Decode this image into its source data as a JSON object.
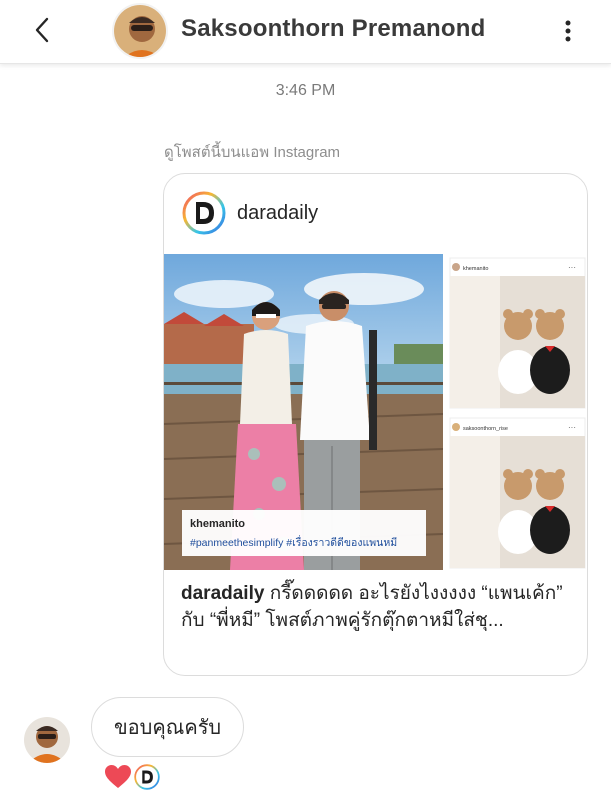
{
  "header": {
    "contact_name": "Saksoonthorn Premanond"
  },
  "chat": {
    "timestamp": "3:46 PM",
    "view_on_app": "ดูโพสต์นี้บนแอพ Instagram",
    "shared_post": {
      "account": "daradaily",
      "photo_overlay_user": "khemanito",
      "photo_overlay_tags": "#panmeethesimplify #เรื่องราวดีดีของแพนหมี",
      "side_post_1_user": "khemanito",
      "side_post_2_user": "saksoonthorn_rise",
      "caption_account": "daradaily",
      "caption_text": "กรี๊ดดดดด อะไรยังไงงงงง “แพนเค้ก” กับ “พี่หมี” โพสต์ภาพคู่รักตุ๊กตาหมีใส่ชุ..."
    },
    "reply": {
      "text": "ขอบคุณครับ",
      "reactions": [
        "heart-icon",
        "daradaily-avatar"
      ]
    }
  },
  "colors": {
    "heart": "#ed4956",
    "border": "#dcdcdc",
    "muted_text": "#8e8e8e",
    "hashtag": "#1f4e9c"
  }
}
